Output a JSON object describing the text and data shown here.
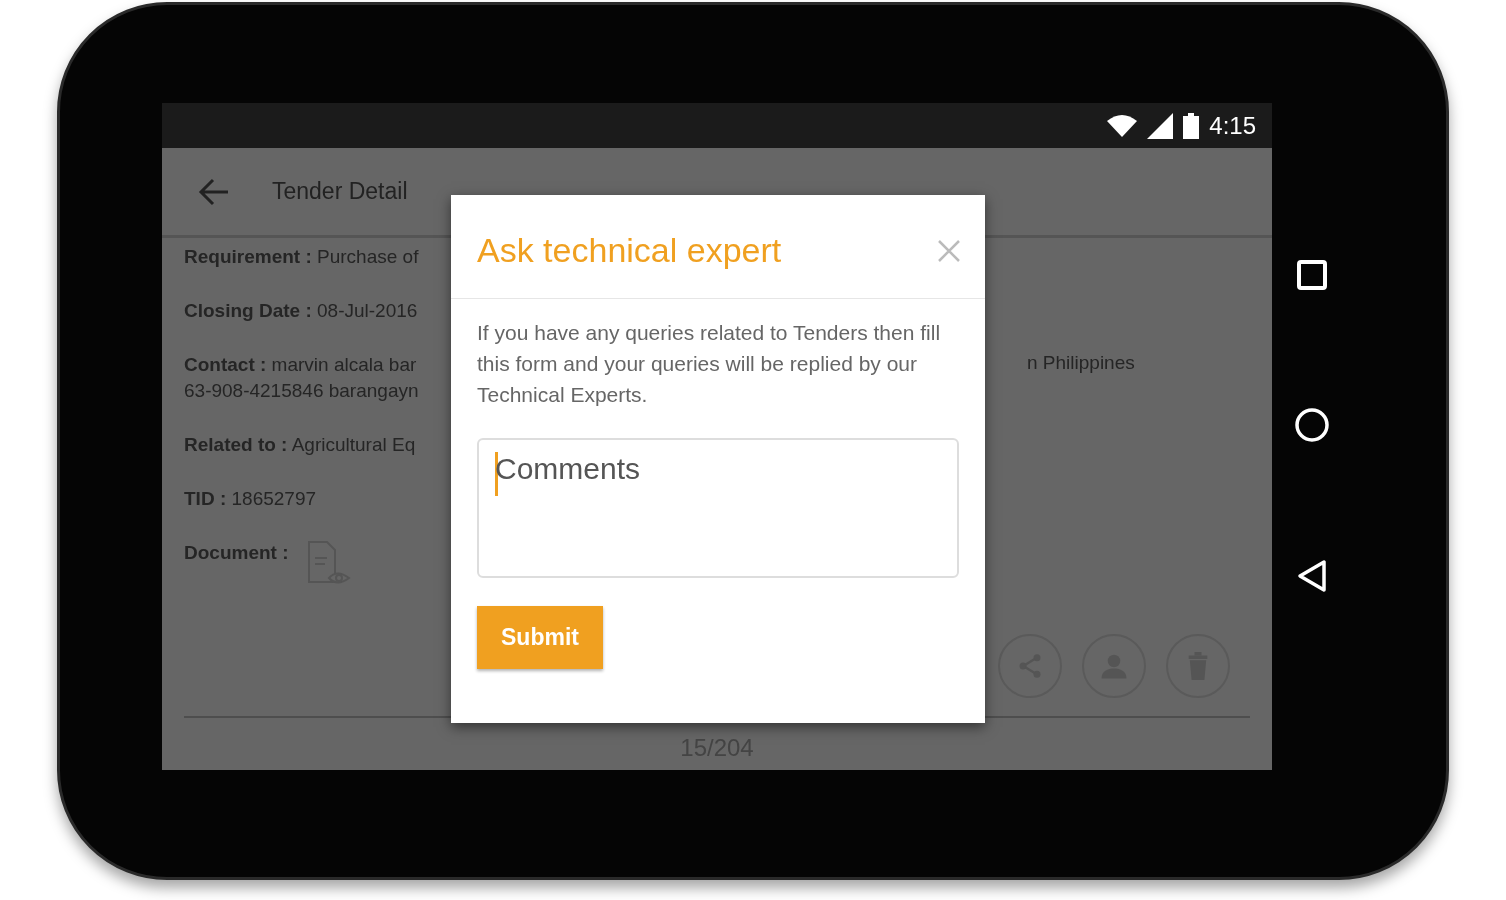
{
  "status_bar": {
    "time": "4:15"
  },
  "app_bar": {
    "title": "Tender Detail"
  },
  "fields": [
    {
      "kind": "text",
      "lines": [
        "**Requirement :** Purchase of"
      ]
    },
    {
      "kind": "text",
      "lines": [
        "**Closing Date :** 08-Jul-2016"
      ]
    },
    {
      "kind": "text",
      "lines": [
        "**Contact :** marvin alcala bar",
        "63-908-4215846 barangayn"
      ],
      "trailing": "n Philippines"
    },
    {
      "kind": "text",
      "lines": [
        "**Related to :** Agricultural Eq"
      ]
    },
    {
      "kind": "text",
      "lines": [
        "**TID :** 18652797"
      ]
    },
    {
      "kind": "document",
      "lines": [
        "**Document :**"
      ]
    }
  ],
  "actions": [
    {
      "kind": "share"
    },
    {
      "kind": "person"
    },
    {
      "kind": "trash"
    }
  ],
  "pager": "15/204",
  "dialog": {
    "title": "Ask technical expert",
    "message": "If you have any queries related to Tenders then fill this form and your queries will be replied by our Technical Experts.",
    "comments": {
      "placeholder": "Comments",
      "focused": true
    },
    "submit": "Submit"
  }
}
